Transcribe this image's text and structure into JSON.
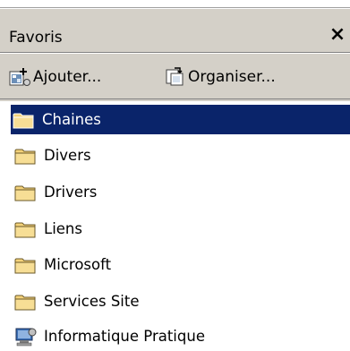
{
  "panel": {
    "title": "Favoris",
    "close_glyph": "✕"
  },
  "toolbar": {
    "add_label": "Ajouter...",
    "add_icon": "add-favorite-icon",
    "organize_label": "Organiser...",
    "organize_icon": "organize-favorites-icon"
  },
  "favorites": [
    {
      "label": "Chaines",
      "icon": "folder-icon",
      "selected": true
    },
    {
      "label": "Divers",
      "icon": "folder-icon",
      "selected": false
    },
    {
      "label": "Drivers",
      "icon": "folder-icon",
      "selected": false
    },
    {
      "label": "Liens",
      "icon": "folder-icon",
      "selected": false
    },
    {
      "label": "Microsoft",
      "icon": "folder-icon",
      "selected": false
    },
    {
      "label": "Services Site",
      "icon": "folder-icon",
      "selected": false
    },
    {
      "label": "Informatique Pratique",
      "icon": "web-shortcut-icon",
      "selected": false
    }
  ],
  "colors": {
    "panel_bg": "#d4d0c8",
    "selection_bg": "#0a246a",
    "folder_yellow": "#f4d27a"
  }
}
